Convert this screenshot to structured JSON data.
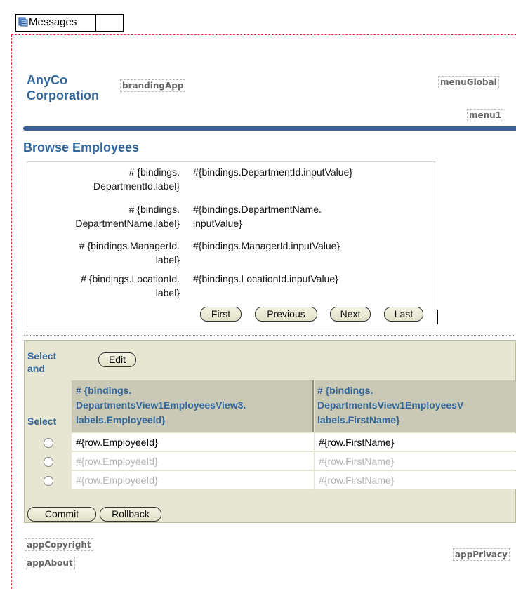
{
  "messages": {
    "label": "Messages"
  },
  "branding": {
    "company_line1": "AnyCo",
    "company_line2": "Corporation",
    "branding_app": "brandingApp",
    "menu_global": "menuGlobal",
    "menu1": "menu1"
  },
  "page": {
    "header": "Browse Employees"
  },
  "form": {
    "rows": [
      {
        "label_line1": "# {bindings.",
        "label_line2": "DepartmentId.label}",
        "value_line1": "#{bindings.DepartmentId.inputValue}",
        "value_line2": ""
      },
      {
        "label_line1": "# {bindings.",
        "label_line2": "DepartmentName.label}",
        "value_line1": "#{bindings.DepartmentName.",
        "value_line2": "inputValue}"
      },
      {
        "label_line1": "# {bindings.ManagerId.",
        "label_line2": "label}",
        "value_line1": "#{bindings.ManagerId.inputValue}",
        "value_line2": ""
      },
      {
        "label_line1": "# {bindings.LocationId.",
        "label_line2": "label}",
        "value_line1": "#{bindings.LocationId.inputValue}",
        "value_line2": ""
      }
    ],
    "nav": {
      "first": "First",
      "previous": "Previous",
      "next": "Next",
      "last": "Last"
    }
  },
  "table": {
    "select_and_line1": "Select",
    "select_and_line2": "and",
    "edit_button": "Edit",
    "select_header": "Select",
    "columns": [
      {
        "line1": "# {bindings.",
        "line2": "DepartmentsView1EmployeesView3.",
        "line3": "labels.EmployeeId}"
      },
      {
        "line1": "# {bindings.",
        "line2": "DepartmentsView1EmployeesV",
        "line3": "labels.FirstName}"
      }
    ],
    "rows": [
      {
        "employee_id": "#{row.EmployeeId}",
        "first_name": "#{row.FirstName}"
      },
      {
        "employee_id": "#{row.EmployeeId}",
        "first_name": "#{row.FirstName}"
      },
      {
        "employee_id": "#{row.EmployeeId}",
        "first_name": "#{row.FirstName}"
      }
    ],
    "commit_button": "Commit",
    "rollback_button": "Rollback"
  },
  "footer": {
    "copyright": "appCopyright",
    "about": "appAbout",
    "privacy": "appPrivacy"
  }
}
